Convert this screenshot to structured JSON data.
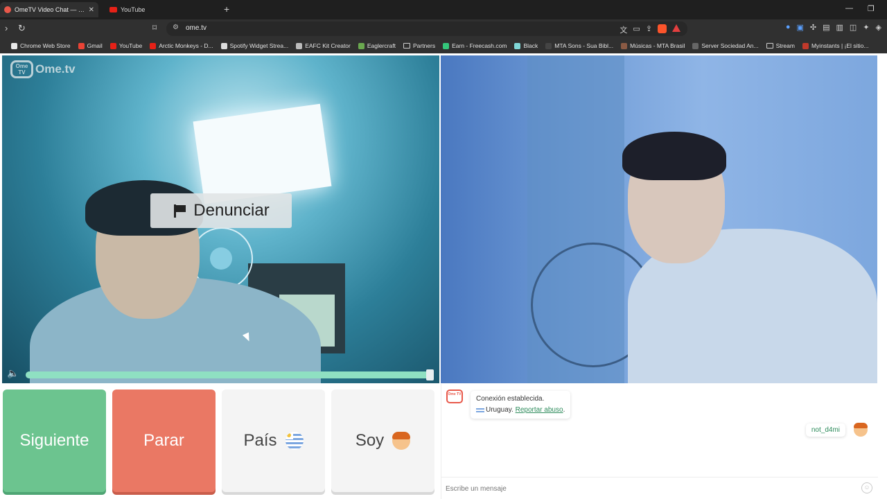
{
  "browser": {
    "tabs": [
      {
        "title": "OmeTV Video Chat — Omegl",
        "close": "✕"
      },
      {
        "title": "YouTube"
      }
    ],
    "new_tab": "+",
    "url": "ome.tv",
    "bookmarks": [
      {
        "label": "Chrome Web Store",
        "color": "#e8e8e8"
      },
      {
        "label": "Gmail",
        "color": "#ea4335"
      },
      {
        "label": "YouTube",
        "color": "#e62117"
      },
      {
        "label": "Arctic Monkeys - D...",
        "color": "#e62117"
      },
      {
        "label": "Spotify Widget Strea...",
        "color": "#dddddd"
      },
      {
        "label": "EAFC Kit Creator",
        "color": "#bbbbbb"
      },
      {
        "label": "Eaglercraft",
        "color": "#6aa84f"
      },
      {
        "label": "Partners",
        "color": "folder"
      },
      {
        "label": "Earn - Freecash.com",
        "color": "#34c77b"
      },
      {
        "label": "Black",
        "color": "#7fd6d6"
      },
      {
        "label": "MTA Sons - Sua Bibl...",
        "color": "#444444"
      },
      {
        "label": "Músicas - MTA Brasil",
        "color": "#8a5a44"
      },
      {
        "label": "Server Sociedad An...",
        "color": "#666666"
      },
      {
        "label": "Stream",
        "color": "folder"
      },
      {
        "label": "Myinstants | ¡El sitio...",
        "color": "#c0392b"
      }
    ]
  },
  "page": {
    "logo_badge": "Ome TV",
    "logo_text": "Ome.tv",
    "report_label": "Denunciar",
    "volume_level": 1.0,
    "buttons": {
      "next": "Siguiente",
      "stop": "Parar",
      "country": "País",
      "gender": "Soy"
    },
    "chat": {
      "logo_badge": "Ome TV",
      "system_line1": "Conexión establecida.",
      "country": "Uruguay.",
      "report_link": "Reportar abuso",
      "report_suffix": ".",
      "username": "not_d4mi",
      "input_placeholder": "Escribe un mensaje"
    }
  }
}
